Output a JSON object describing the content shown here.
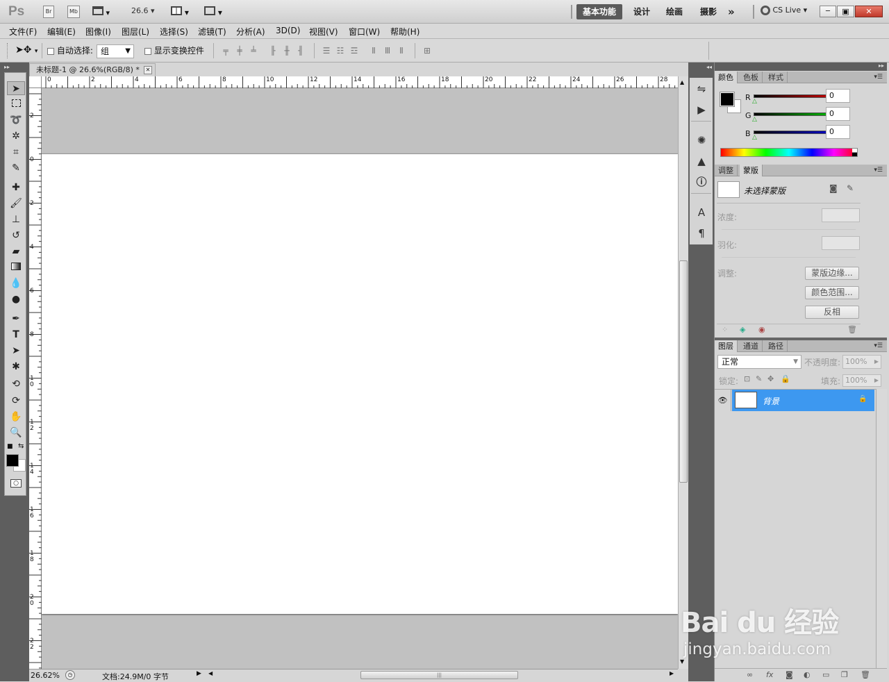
{
  "app": {
    "logo": "Ps",
    "br_btn": "Br",
    "mb_btn": "Mb",
    "zoom_select": "26.6",
    "workspaces": [
      "基本功能",
      "设计",
      "绘画",
      "摄影"
    ],
    "more": "»",
    "cs_live": "CS Live",
    "win_min": "─",
    "win_max": "▣",
    "win_close": "✕"
  },
  "menu": [
    "文件(F)",
    "编辑(E)",
    "图像(I)",
    "图层(L)",
    "选择(S)",
    "滤镜(T)",
    "分析(A)",
    "3D(D)",
    "视图(V)",
    "窗口(W)",
    "帮助(H)"
  ],
  "options": {
    "auto_select_label": "自动选择:",
    "auto_select_value": "组",
    "show_transform_label": "显示变换控件"
  },
  "document": {
    "tab_title": "未标题-1 @ 26.6%(RGB/8) *",
    "tab_close": "✕",
    "ruler_h_labels": [
      "0",
      "2",
      "4",
      "6",
      "8",
      "10",
      "12",
      "14",
      "16",
      "18",
      "20",
      "22",
      "24",
      "26",
      "28"
    ],
    "ruler_v_labels": [
      "2",
      "0",
      "2",
      "4",
      "6",
      "8",
      "1 0",
      "1 2",
      "1 4",
      "1 6",
      "1 8",
      "2 0",
      "2 2"
    ]
  },
  "status": {
    "zoom": "26.62%",
    "doc_info": "文档:24.9M/0 字节"
  },
  "color_panel": {
    "tabs": [
      "颜色",
      "色板",
      "样式"
    ],
    "channels": [
      {
        "label": "R",
        "value": "0",
        "color": "#cc0000"
      },
      {
        "label": "G",
        "value": "0",
        "color": "#00b400"
      },
      {
        "label": "B",
        "value": "0",
        "color": "#0000cc"
      }
    ]
  },
  "masks_panel": {
    "tabs": [
      "调整",
      "蒙版"
    ],
    "no_mask_label": "未选择蒙版",
    "density_label": "浓度:",
    "feather_label": "羽化:",
    "refine_label": "调整:",
    "buttons": [
      "蒙版边缘...",
      "颜色范围...",
      "反相"
    ]
  },
  "layers_panel": {
    "tabs": [
      "图层",
      "通道",
      "路径"
    ],
    "blend_mode": "正常",
    "opacity_label": "不透明度:",
    "opacity_value": "100%",
    "lock_label": "锁定:",
    "fill_label": "填充:",
    "fill_value": "100%",
    "layers": [
      {
        "name": "背景",
        "selected": true,
        "locked": true
      }
    ]
  },
  "watermark": {
    "brand": "Bai du 经验",
    "url": "jingyan.baidu.com"
  }
}
